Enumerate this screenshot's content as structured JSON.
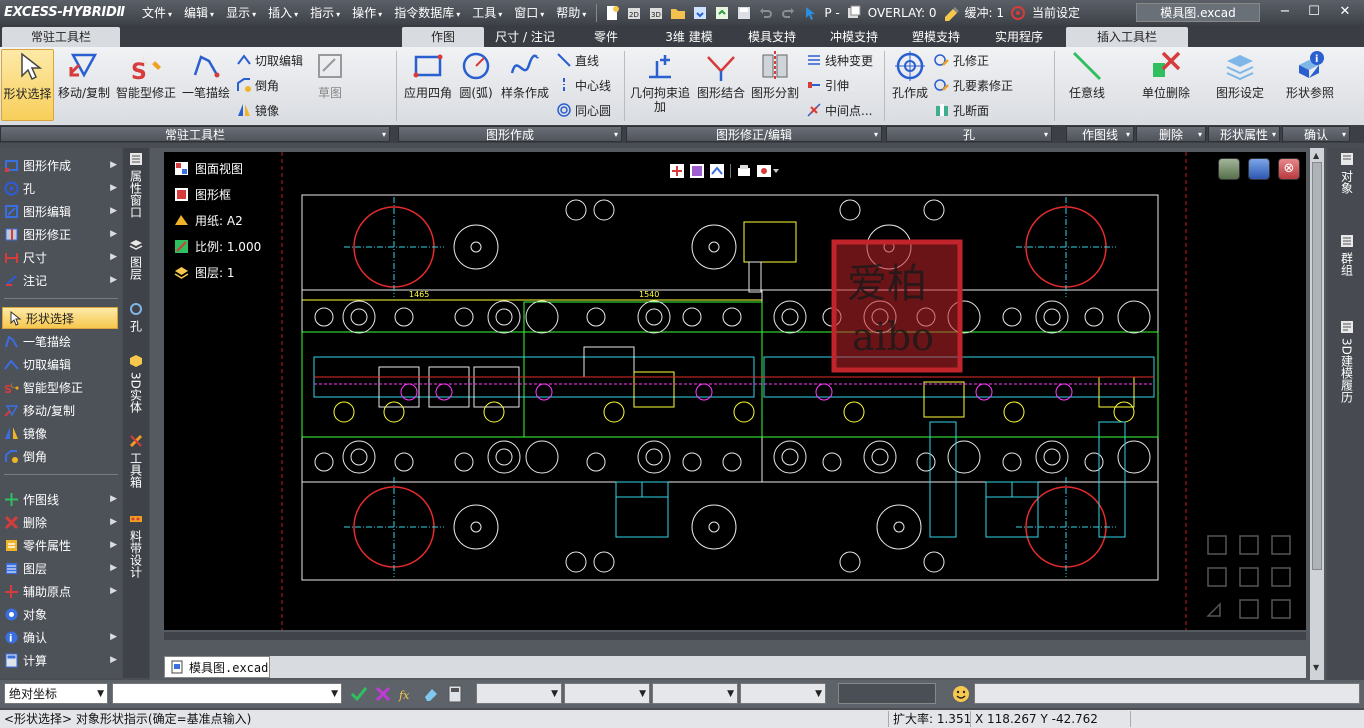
{
  "app": {
    "logo": "EXCESS-HYBRIDⅡ",
    "document_title": "模具图.excad"
  },
  "menu": [
    {
      "label": "文件"
    },
    {
      "label": "编辑"
    },
    {
      "label": "显示"
    },
    {
      "label": "插入"
    },
    {
      "label": "指示"
    },
    {
      "label": "操作"
    },
    {
      "label": "指令数据库"
    },
    {
      "label": "工具"
    },
    {
      "label": "窗口"
    },
    {
      "label": "帮助"
    }
  ],
  "quick_access": {
    "p_label": "P -",
    "overlay_label": "OVERLAY: 0",
    "buffer_label": "缓冲: 1",
    "settings_label": "当前设定"
  },
  "ribbon_tabs": [
    {
      "label": "常驻工具栏",
      "active": true
    },
    {
      "label": "作图",
      "active": true
    },
    {
      "label": "尺寸 / 注记",
      "active": false
    },
    {
      "label": "零件",
      "active": false
    },
    {
      "label": "3维 建模",
      "active": false
    },
    {
      "label": "模具支持",
      "active": false
    },
    {
      "label": "冲模支持",
      "active": false
    },
    {
      "label": "塑模支持",
      "active": false
    },
    {
      "label": "实用程序",
      "active": false
    },
    {
      "label": "插入工具栏",
      "active": true
    }
  ],
  "ribbon": {
    "shape_select": "形状选择",
    "move_copy": "移动/复制",
    "smart_modify": "智能型修正",
    "single_stroke": "一笔描绘",
    "cut_edit": "切取编辑",
    "chamfer": "倒角",
    "mirror": "镜像",
    "sketch": "草图",
    "rect": "应用四角",
    "circle_arc": "圆(弧)",
    "spline": "样条作成",
    "line": "直线",
    "center_line": "中心线",
    "concentric": "同心圆",
    "constraint_add_1": "几何拘束追",
    "constraint_add_2": "加",
    "shape_join": "图形结合",
    "shape_split": "图形分割",
    "line_type_change": "线种变更",
    "leader": "引伸",
    "midpoint": "中间点...",
    "hole_create": "孔作成",
    "hole_modify": "孔修正",
    "hole_element_modify": "孔要素修正",
    "hole_section": "孔断面",
    "arbitrary_line": "任意线",
    "unit_delete": "单位删除",
    "shape_setting": "图形设定",
    "shape_ref": "形状参照"
  },
  "ribbon_groups": [
    {
      "label": "常驻工具栏"
    },
    {
      "label": "图形作成"
    },
    {
      "label": "图形修正/编辑"
    },
    {
      "label": "孔"
    },
    {
      "label": "作图线"
    },
    {
      "label": "删除"
    },
    {
      "label": "形状属性"
    },
    {
      "label": "确认"
    }
  ],
  "left_panel": {
    "group1": [
      {
        "label": "图形作成",
        "icon": "draw-shape-icon",
        "color": "#3a6fe0"
      },
      {
        "label": "孔",
        "icon": "hole-icon",
        "color": "#2f5bd8"
      },
      {
        "label": "图形编辑",
        "icon": "shape-edit-icon",
        "color": "#3a6fe0"
      },
      {
        "label": "图形修正",
        "icon": "shape-modify-icon",
        "color": "#3a6fe0"
      },
      {
        "label": "尺寸",
        "icon": "dimension-icon",
        "color": "#d63c3c"
      },
      {
        "label": "注记",
        "icon": "annotation-icon",
        "color": "#2f5bd8"
      }
    ],
    "group2": [
      {
        "label": "形状选择",
        "icon": "cursor-icon",
        "color": "#f0b429",
        "selected": true
      },
      {
        "label": "一笔描绘",
        "icon": "stroke-icon",
        "color": "#3a6fe0"
      },
      {
        "label": "切取编辑",
        "icon": "cut-edit-icon",
        "color": "#3a6fe0"
      },
      {
        "label": "智能型修正",
        "icon": "smart-wrench-icon",
        "color": "#f0a020"
      },
      {
        "label": "移动/复制",
        "icon": "move-copy-icon",
        "color": "#d63c3c"
      },
      {
        "label": "镜像",
        "icon": "mirror-icon",
        "color": "#3a6fe0"
      },
      {
        "label": "倒角",
        "icon": "chamfer-icon",
        "color": "#f0b429"
      }
    ],
    "group3": [
      {
        "label": "作图线",
        "icon": "construction-line-icon",
        "color": "#2fbf5f"
      },
      {
        "label": "删除",
        "icon": "delete-x-icon",
        "color": "#d63c3c"
      },
      {
        "label": "零件属性",
        "icon": "part-attribute-icon",
        "color": "#f0b429"
      },
      {
        "label": "图层",
        "icon": "layer-icon",
        "color": "#3a6fe0"
      },
      {
        "label": "辅助原点",
        "icon": "aux-origin-icon",
        "color": "#d63c3c"
      },
      {
        "label": "对象",
        "icon": "object-icon",
        "color": "#3a6fe0"
      },
      {
        "label": "确认",
        "icon": "confirm-icon",
        "color": "#3a6fe0"
      },
      {
        "label": "计算",
        "icon": "calculator-icon",
        "color": "#3a6fe0"
      }
    ]
  },
  "side_tabs": [
    {
      "label": "属性窗口"
    },
    {
      "label": "图层"
    },
    {
      "label": "孔"
    },
    {
      "label": "3D实体"
    },
    {
      "label": "工具箱"
    },
    {
      "label": "料带设计"
    }
  ],
  "right_tabs": [
    {
      "label": "对象"
    },
    {
      "label": "群组"
    },
    {
      "label": "3D建模履历"
    }
  ],
  "canvas_info": {
    "view": "图面视图",
    "frame": "图形框",
    "paper": "用纸: A2",
    "scale": "比例: 1.000",
    "layer": "图层: 1"
  },
  "watermark": {
    "cn": "爱柏",
    "en": "aibo",
    "color": "#c2242b"
  },
  "drawing_dims": {
    "left": "1465",
    "right": "1540"
  },
  "doc_tab": {
    "label": "模具图.excad"
  },
  "command": {
    "coord_mode": "绝对坐标",
    "input_value": ""
  },
  "status": {
    "message": "<形状选择> 对象形状指示(确定=基准点输入)",
    "zoom": "扩大率: 1.351",
    "coords": "X 118.267 Y -42.762"
  },
  "colors": {
    "accent": "#f6c84e",
    "canvas_bg": "#000000",
    "cad_red": "#e52b2b",
    "cad_cyan": "#35d5e8",
    "cad_white": "#ffffff",
    "cad_yellow": "#ffff3a",
    "cad_green": "#3aff3a",
    "cad_magenta": "#ff3aff"
  }
}
